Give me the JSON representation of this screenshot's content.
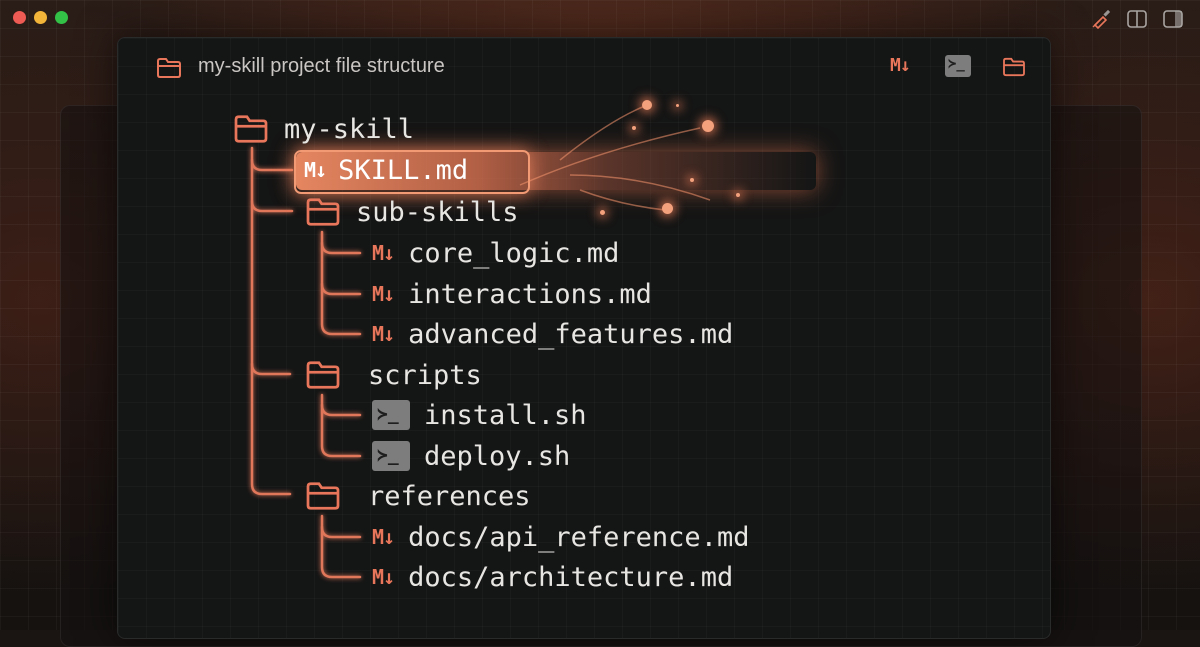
{
  "window": {
    "controls": [
      "close",
      "minimize",
      "maximize"
    ],
    "toolbar_icons": [
      "paintbrush-icon",
      "split-view-icon",
      "sidebar-icon"
    ]
  },
  "header": {
    "title": "my-skill project file structure",
    "md_badge": "M↓",
    "terminal_symbol": "≻_"
  },
  "tree": {
    "root": {
      "label": "my-skill",
      "icon": "folder-icon"
    },
    "items": [
      {
        "label": "SKILL.md",
        "icon": "markdown-icon",
        "highlighted": true
      },
      {
        "label": "sub-skills",
        "icon": "folder-icon"
      },
      {
        "label": "core_logic.md",
        "icon": "markdown-icon"
      },
      {
        "label": "interactions.md",
        "icon": "markdown-icon"
      },
      {
        "label": "advanced_features.md",
        "icon": "markdown-icon"
      },
      {
        "label": "scripts",
        "icon": "folder-icon"
      },
      {
        "label": "install.sh",
        "icon": "terminal-icon"
      },
      {
        "label": "deploy.sh",
        "icon": "terminal-icon"
      },
      {
        "label": "references",
        "icon": "folder-icon"
      },
      {
        "label": "docs/api_reference.md",
        "icon": "markdown-icon"
      },
      {
        "label": "docs/architecture.md",
        "icon": "markdown-icon"
      }
    ],
    "md_badge": "M↓",
    "terminal_symbol": "≻_"
  },
  "colors": {
    "accent": "#e8765a",
    "tree_line": "#e0775a",
    "background": "#141515",
    "text": "#e8e6e3"
  }
}
